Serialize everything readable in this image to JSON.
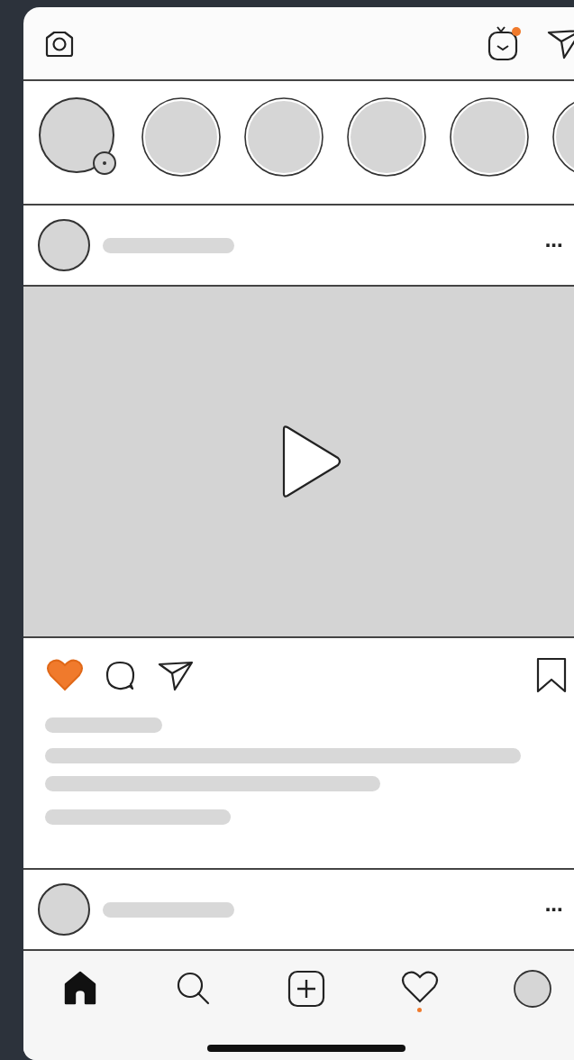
{
  "top_bar": {
    "tv_badge": true
  },
  "stories": [
    {
      "kind": "own"
    },
    {
      "kind": "friend"
    },
    {
      "kind": "friend"
    },
    {
      "kind": "friend"
    },
    {
      "kind": "friend"
    },
    {
      "kind": "friend"
    }
  ],
  "posts": [
    {
      "kind": "video",
      "more": "···",
      "liked": true,
      "saved": false
    },
    {
      "kind": "header_only",
      "more": "···"
    }
  ],
  "tab_bar": [
    {
      "kind": "home",
      "selected": true,
      "badge": false
    },
    {
      "kind": "search",
      "selected": false,
      "badge": false
    },
    {
      "kind": "add",
      "selected": false,
      "badge": false
    },
    {
      "kind": "activity",
      "selected": false,
      "badge": true
    },
    {
      "kind": "profile",
      "selected": false,
      "badge": false
    }
  ]
}
